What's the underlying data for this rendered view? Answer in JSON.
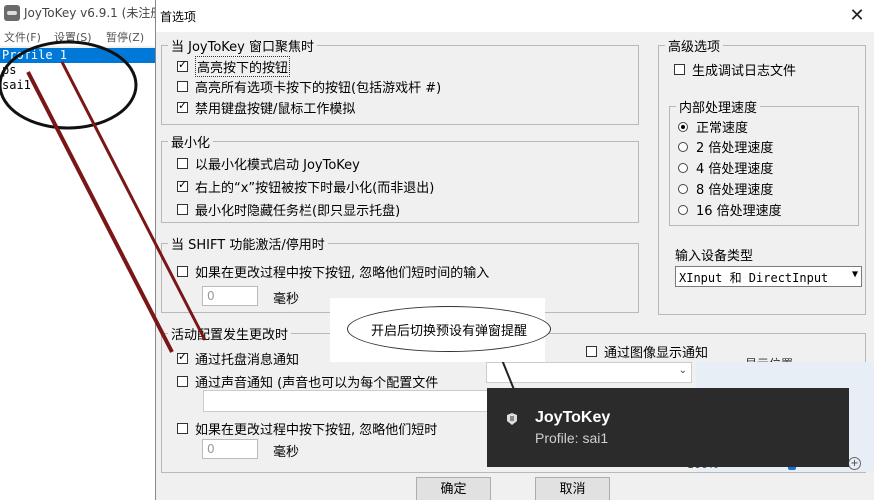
{
  "main": {
    "title": "JoyToKey v6.9.1 (未注册",
    "menu": [
      "文件(F)",
      "设置(S)",
      "暂停(Z)"
    ],
    "profiles": [
      "Profile 1",
      "ps",
      "sai1"
    ]
  },
  "dialog": {
    "title": "首选项",
    "close_label": "✕",
    "focus_group": {
      "title": "当 JoyToKey 窗口聚焦时",
      "items": [
        {
          "label": "高亮按下的按钮",
          "checked": true
        },
        {
          "label": "高亮所有选项卡按下的按钮(包括游戏杆 #)",
          "checked": false
        },
        {
          "label": "禁用键盘按键/鼠标工作模拟",
          "checked": true
        }
      ]
    },
    "minimize_group": {
      "title": "最小化",
      "items": [
        {
          "label": "以最小化模式启动 JoyToKey",
          "checked": false
        },
        {
          "label": "右上的“x”按钮被按下时最小化(而非退出)",
          "checked": true
        },
        {
          "label": "最小化时隐藏任务栏(即只显示托盘)",
          "checked": false
        }
      ]
    },
    "shift_group": {
      "title": "当 SHIFT 功能激活/停用时",
      "item": {
        "label": "如果在更改过程中按下按钮, 忽略他们短时间的输入",
        "checked": false
      },
      "ms_value": "0",
      "ms_unit": "毫秒"
    },
    "profile_change_group": {
      "title": "活动配置发生更改时",
      "tray_notify": {
        "label": "通过托盘消息通知",
        "checked": true
      },
      "sound_notify": {
        "label": "通过声音通知 (声音也可以为每个配置文件",
        "checked": false
      },
      "image_notify": {
        "label": "通过图像显示通知",
        "checked": false
      },
      "image_position_label": "显示位置",
      "ignore_item": {
        "label": "如果在更改过程中按下按钮, 忽略他们短时",
        "checked": false
      },
      "ms_value": "0",
      "ms_unit": "毫秒",
      "zoom_label": "100%"
    },
    "advanced_group": {
      "title": "高级选项",
      "debug_log": {
        "label": "生成调试日志文件",
        "checked": false
      },
      "speed_group": {
        "title": "内部处理速度",
        "options": [
          {
            "label": "正常速度",
            "checked": true
          },
          {
            "label": "2 倍处理速度",
            "checked": false
          },
          {
            "label": "4 倍处理速度",
            "checked": false
          },
          {
            "label": "8 倍处理速度",
            "checked": false
          },
          {
            "label": "16 倍处理速度",
            "checked": false
          }
        ]
      },
      "device_type_label": "输入设备类型",
      "device_type_value": "XInput 和 DirectInput"
    },
    "ok_label": "确定",
    "cancel_label": "取消"
  },
  "annotation": {
    "callout_text": "开启后切换预设有弹窗提醒",
    "color": "#7a1616"
  },
  "toast": {
    "title": "JoyToKey",
    "body": "Profile: sai1"
  }
}
